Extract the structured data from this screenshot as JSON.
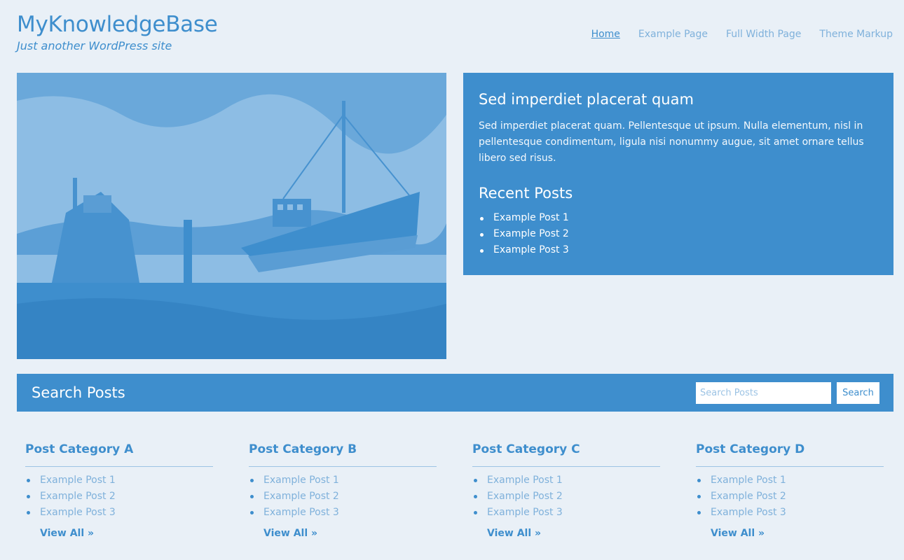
{
  "site": {
    "title": "MyKnowledgeBase",
    "tagline": "Just another WordPress site"
  },
  "nav": {
    "items": [
      {
        "label": "Home",
        "active": true
      },
      {
        "label": "Example Page"
      },
      {
        "label": "Full Width Page"
      },
      {
        "label": "Theme Markup"
      }
    ]
  },
  "hero": {
    "image_subject": "boats-in-harbor-image",
    "title": "Sed imperdiet placerat quam",
    "text": "Sed imperdiet placerat quam. Pellentesque ut ipsum. Nulla elementum, nisl in pellentesque condimentum, ligula nisi nonummy augue, sit amet ornare tellus libero sed risus.",
    "recent_title": "Recent Posts",
    "recent_posts": [
      "Example Post 1",
      "Example Post 2",
      "Example Post 3"
    ]
  },
  "search": {
    "title": "Search Posts",
    "placeholder": "Search Posts",
    "button_label": "Search"
  },
  "categories": [
    {
      "title": "Post Category A",
      "posts": [
        "Example Post 1",
        "Example Post 2",
        "Example Post 3"
      ],
      "view_all": "View All »"
    },
    {
      "title": "Post Category B",
      "posts": [
        "Example Post 1",
        "Example Post 2",
        "Example Post 3"
      ],
      "view_all": "View All »"
    },
    {
      "title": "Post Category C",
      "posts": [
        "Example Post 1",
        "Example Post 2",
        "Example Post 3"
      ],
      "view_all": "View All »"
    },
    {
      "title": "Post Category D",
      "posts": [
        "Example Post 1",
        "Example Post 2",
        "Example Post 3"
      ],
      "view_all": "View All »"
    }
  ],
  "colors": {
    "background": "#e9f0f7",
    "accent": "#3e8ecd",
    "link_light": "#7fb1db"
  }
}
